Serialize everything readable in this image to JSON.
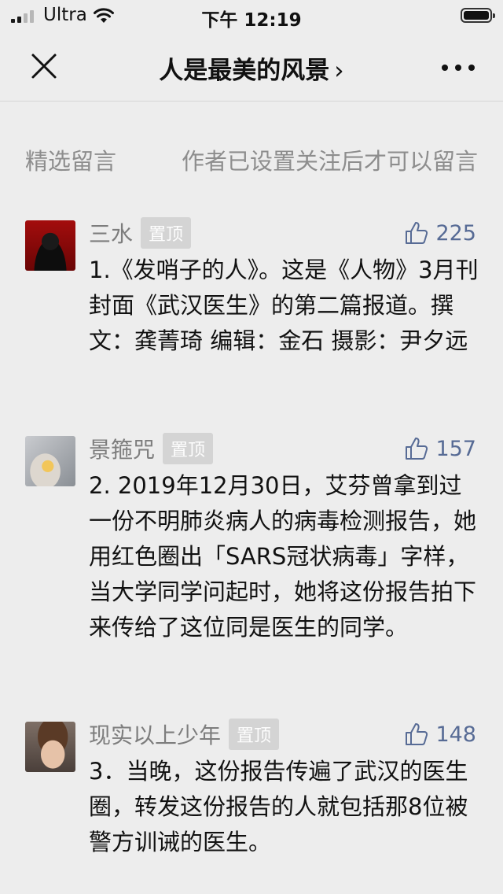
{
  "status": {
    "carrier": "Ultra",
    "time": "下午 12:19"
  },
  "nav": {
    "title": "人是最美的风景",
    "chevron": "›"
  },
  "section": {
    "left": "精选留言",
    "right": "作者已设置关注后才可以留言"
  },
  "comments": [
    {
      "name": "三水",
      "pin": "置顶",
      "likes": "225",
      "text": "1.《发哨子的人》。这是《人物》3月刊封面《武汉医生》的第二篇报道。撰文：龚菁琦 编辑：金石  摄影：尹夕远"
    },
    {
      "name": "景箍咒",
      "pin": "置顶",
      "likes": "157",
      "text": "2. 2019年12月30日，艾芬曾拿到过一份不明肺炎病人的病毒检测报告，她用红色圈出「SARS冠状病毒」字样，当大学同学问起时，她将这份报告拍下来传给了这位同是医生的同学。"
    },
    {
      "name": "现实以上少年",
      "pin": "置顶",
      "likes": "148",
      "text": "3．当晚，这份报告传遍了武汉的医生圈，转发这份报告的人就包括那8位被警方训诫的医生。"
    }
  ],
  "colors": {
    "background": "#ededed",
    "link": "#576b95",
    "muted": "#8d8d8d"
  }
}
